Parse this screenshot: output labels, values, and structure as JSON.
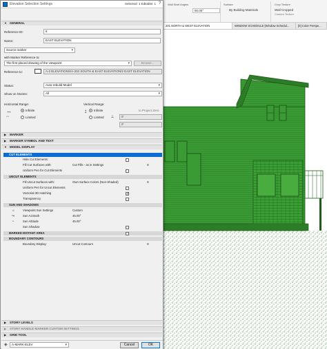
{
  "dialog": {
    "title": "Elevation Selection Settings",
    "selected_info": "Selected: 1 Editable: 1",
    "help": "?"
  },
  "general": {
    "header": "GENERAL",
    "reference_id_label": "Reference ID:",
    "reference_id_value": "6",
    "name_label": "Name:",
    "name_value": "EAST ELEVATION",
    "marker_type_value": "Source marker",
    "with_marker_ref_label": "with Marker Reference to:",
    "marker_ref_value": "The first placed drawing of the viewpoint",
    "browse_label": "Browse...",
    "reference_to_label": "Reference to:",
    "reference_to_value": "A-2 ELEVATIONS/A-202 SOUTH & EAST ELEVATION/2 EAST ELEVATION",
    "status_label": "Status:",
    "status_value": "Auto-rebuild Model",
    "show_on_stories_label": "Show on Stories:",
    "show_on_stories_value": "All",
    "horizontal_range_label": "Horizontal Range:",
    "h_infinite": "Infinite",
    "h_limited": "Limited",
    "vertical_range_label": "Vertical Range:",
    "v_infinite": "Infinite",
    "v_limited": "Limited",
    "to_project_zero": "to Project Zero",
    "v_value1": "0'",
    "v_value2": "0'"
  },
  "sections": {
    "marker": "MARKER",
    "marker_symbol_text": "MARKER SYMBOL AND TEXT",
    "model_display": "MODEL DISPLAY",
    "story_levels": "STORY LEVELS",
    "story_handle": "STORY HANDLE MARKER CUSTOM SETTINGS",
    "grid_tool": "GRID TOOL"
  },
  "model_display": {
    "cut_elements": "CUT ELEMENTS",
    "hide_cut_elements": "Hide Cut Elements:",
    "fill_cut_surfaces": "Fill Cut Surfaces with:",
    "fill_cut_surfaces_value": "Cut Fills - as in Settings",
    "uniform_pen_cut": "Uniform Pen for Cut Elements",
    "uncut_elements": "UNCUT ELEMENTS",
    "fill_uncut_surfaces": "Fill Uncut Surfaces with:",
    "fill_uncut_surfaces_value": "Own Surface Colors (Non-Shaded)",
    "uniform_pen_uncut": "Uniform Pen for Uncut Elements",
    "vectorial_hatching": "Vectorial 3D Hatching",
    "vectorial_hatching_checked": "✓",
    "transparency": "Transparency",
    "sun_and_shadows": "SUN AND SHADOWS",
    "viewpoint_sun_settings": "Viewpoint Sun Settings",
    "viewpoint_sun_settings_value": "Custom",
    "sun_azimuth": "Sun Azimuth",
    "sun_azimuth_value": "45.00°",
    "sun_altitude": "Sun Altitude",
    "sun_altitude_value": "45.00°",
    "sun_shadow": "Sun Shadow",
    "marked_distant_area": "MARKED DISTANT AREA",
    "boundary_contours": "BOUNDARY CONTOURS",
    "boundary_display": "Boundary Display:",
    "boundary_display_value": "Uncut Contours"
  },
  "bottom": {
    "layer_value": "A-MARK-ELEV",
    "cancel_label": "Cancel",
    "ok_label": "OK"
  },
  "info_box": {
    "wall_start_angles_label": "Wall Start Angles",
    "wall_start_angle_value": "90.00°",
    "surface_label": "Surface",
    "surface_value": "By Building Materials",
    "crop_texture_label": "Crop Texture",
    "crop_texture_value": "Wall Cropped",
    "custom_texture_label": "Custom Texture"
  },
  "tabs": [
    {
      "label": "201 NORTH & WEST ELEVATION"
    },
    {
      "label": "WINDOW SCHEDULE [Window Schedul..."
    },
    {
      "label": "[0] Color Perspe..."
    }
  ],
  "colors": {
    "house_green": "#3a9a33",
    "house_dark": "#1e5e1a",
    "selection_blue": "#0b6cd3"
  }
}
